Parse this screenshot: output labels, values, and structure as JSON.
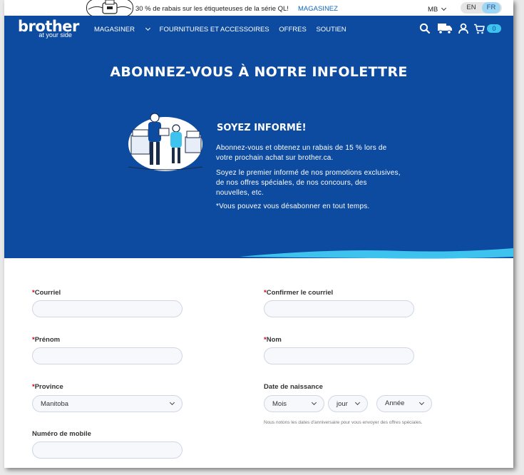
{
  "promo": {
    "message": "30 % de rabais sur les étiqueteuses de la série QL!",
    "link": "MAGASINEZ",
    "province": "MB",
    "lang_en": "EN",
    "lang_fr": "FR"
  },
  "header": {
    "logo_word": "brother",
    "logo_tag": "at your side",
    "nav": [
      "MAGASINER",
      "FOURNITURES ET ACCESSOIRES",
      "OFFRES",
      "SOUTIEN"
    ],
    "cart_count": "0"
  },
  "hero": {
    "title": "ABONNEZ-VOUS À NOTRE INFOLETTRE",
    "info_title": "SOYEZ INFORMÉ!",
    "p1": "Abonnez-vous et obtenez un rabais de 15 % lors de votre prochain achat sur brother.ca.",
    "p2": "Soyez le premier informé de nos promotions exclusives, de nos offres spéciales, de nos concours, des nouvelles, etc.",
    "p3": "*Vous pouvez vous désabonner en tout temps."
  },
  "form": {
    "required_mark": "*",
    "email_label": "Courriel",
    "confirm_email_label": "Confirmer le courriel",
    "first_name_label": "Prénom",
    "last_name_label": "Nom",
    "province_label": "Province",
    "province_value": "Manitoba",
    "birthdate_label": "Date de naissance",
    "month_value": "Mois",
    "day_value": "jour",
    "year_value": "Année",
    "birthdate_note": "Nous notons les dates d'anniversaire pour vous envoyer des offres spéciales.",
    "mobile_label": "Numéro de mobile"
  },
  "colors": {
    "brand_blue": "#0d4ba0",
    "accent_cyan": "#3ec3ee",
    "required_red": "#d0021b"
  }
}
